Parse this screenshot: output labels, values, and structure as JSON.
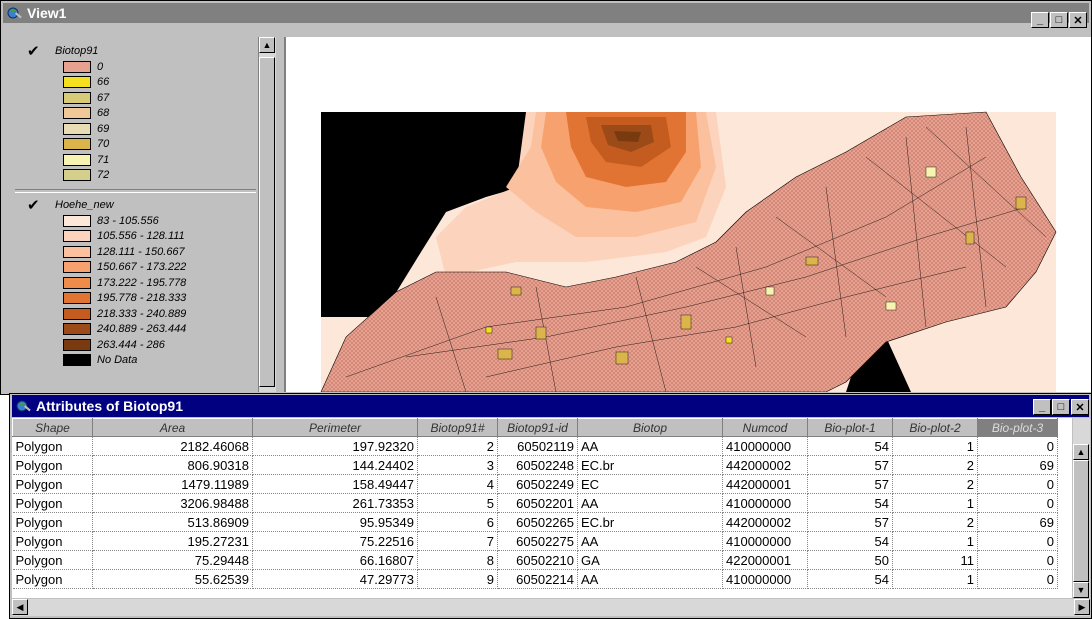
{
  "view_window": {
    "title": "View1",
    "legend": [
      {
        "name": "Biotop91",
        "checked": true,
        "classes": [
          {
            "label": "0",
            "color": "#e6a190"
          },
          {
            "label": "66",
            "color": "#f5e020"
          },
          {
            "label": "67",
            "color": "#d8cb78"
          },
          {
            "label": "68",
            "color": "#f0c898"
          },
          {
            "label": "69",
            "color": "#e8dcb4"
          },
          {
            "label": "70",
            "color": "#dcb44c"
          },
          {
            "label": "71",
            "color": "#f7f3b0"
          },
          {
            "label": "72",
            "color": "#d4d08c"
          }
        ]
      },
      {
        "name": "Hoehe_new",
        "checked": true,
        "classes": [
          {
            "label": "83 - 105.556",
            "color": "#fde7d8"
          },
          {
            "label": "105.556 - 128.111",
            "color": "#fcd3bd"
          },
          {
            "label": "128.111 - 150.667",
            "color": "#fbc09e"
          },
          {
            "label": "150.667 - 173.222",
            "color": "#f7a26e"
          },
          {
            "label": "173.222 - 195.778",
            "color": "#ef8c4c"
          },
          {
            "label": "195.778 - 218.333",
            "color": "#e17432"
          },
          {
            "label": "218.333 - 240.889",
            "color": "#c45c20"
          },
          {
            "label": "240.889 - 263.444",
            "color": "#9c4a18"
          },
          {
            "label": "263.444 - 286",
            "color": "#7a3a10"
          },
          {
            "label": "No Data",
            "color": "#000000"
          }
        ]
      }
    ]
  },
  "attributes_window": {
    "title": "Attributes of Biotop91",
    "columns": [
      "Shape",
      "Area",
      "Perimeter",
      "Biotop91#",
      "Biotop91-id",
      "Biotop",
      "Numcod",
      "Bio-plot-1",
      "Bio-plot-2",
      "Bio-plot-3"
    ],
    "selected_column": "Bio-plot-3",
    "rows": [
      [
        "Polygon",
        "2182.46068",
        "197.92320",
        "2",
        "60502119",
        "AA",
        "410000000",
        "54",
        "1",
        "0"
      ],
      [
        "Polygon",
        "806.90318",
        "144.24402",
        "3",
        "60502248",
        "EC.br",
        "442000002",
        "57",
        "2",
        "69"
      ],
      [
        "Polygon",
        "1479.11989",
        "158.49447",
        "4",
        "60502249",
        "EC",
        "442000001",
        "57",
        "2",
        "0"
      ],
      [
        "Polygon",
        "3206.98488",
        "261.73353",
        "5",
        "60502201",
        "AA",
        "410000000",
        "54",
        "1",
        "0"
      ],
      [
        "Polygon",
        "513.86909",
        "95.95349",
        "6",
        "60502265",
        "EC.br",
        "442000002",
        "57",
        "2",
        "69"
      ],
      [
        "Polygon",
        "195.27231",
        "75.22516",
        "7",
        "60502275",
        "AA",
        "410000000",
        "54",
        "1",
        "0"
      ],
      [
        "Polygon",
        "75.29448",
        "66.16807",
        "8",
        "60502210",
        "GA",
        "422000001",
        "50",
        "11",
        "0"
      ],
      [
        "Polygon",
        "55.62539",
        "47.29773",
        "9",
        "60502214",
        "AA",
        "410000000",
        "54",
        "1",
        "0"
      ]
    ]
  }
}
